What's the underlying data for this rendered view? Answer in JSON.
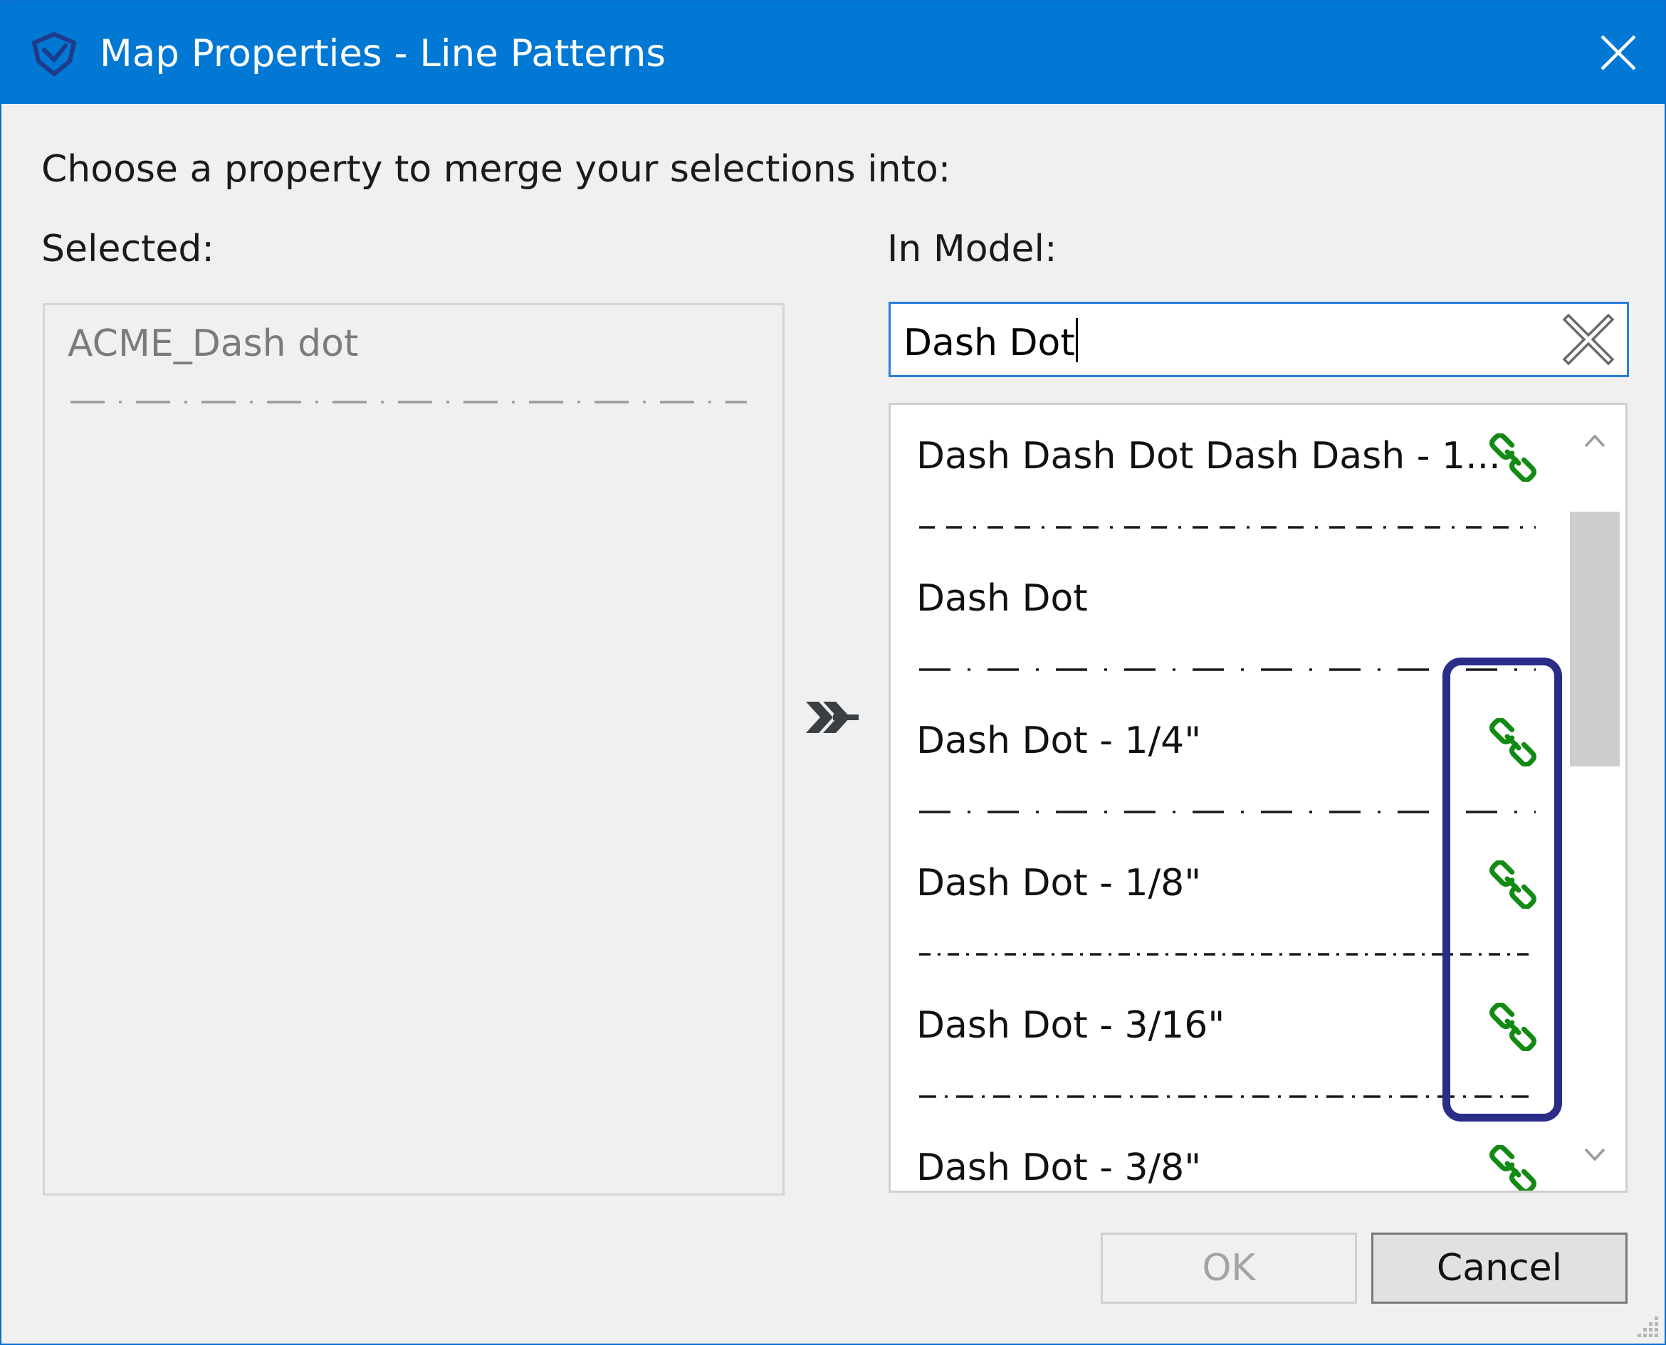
{
  "window": {
    "title": "Map Properties - Line Patterns",
    "icon": "app-logo-icon",
    "close_icon": "close-icon"
  },
  "dialog": {
    "prompt": "Choose a property to merge your selections into:",
    "selected_label": "Selected:",
    "model_label": "In Model:"
  },
  "selected": {
    "name": "ACME_Dash dot",
    "pattern": "dash-dot"
  },
  "search": {
    "value": "Dash Dot",
    "clear_icon": "clear-search-icon"
  },
  "merge_icon": "merge-arrow-icon",
  "list": {
    "items": [
      {
        "name": "Dash Dash Dot Dash Dash - 1...",
        "linked": true,
        "pattern": "dash-dash-dot"
      },
      {
        "name": "Dash Dot",
        "linked": false,
        "pattern": "dash-dot-wide"
      },
      {
        "name": "Dash Dot - 1/4\"",
        "linked": true,
        "pattern": "dash-dot-wide"
      },
      {
        "name": "Dash Dot - 1/8\"",
        "linked": true,
        "pattern": "dash-dot-small"
      },
      {
        "name": "Dash Dot - 3/16\"",
        "linked": true,
        "pattern": "dash-dot-medium"
      },
      {
        "name": "Dash Dot - 3/8\"",
        "linked": true,
        "pattern": "dash-dot-wide"
      }
    ],
    "link_icon": "link-icon",
    "link_color": "#138a13"
  },
  "buttons": {
    "ok": "OK",
    "cancel": "Cancel"
  },
  "colors": {
    "titlebar": "#0078d4",
    "highlight_box": "#2b2b88",
    "search_border": "#2a7fd8"
  }
}
